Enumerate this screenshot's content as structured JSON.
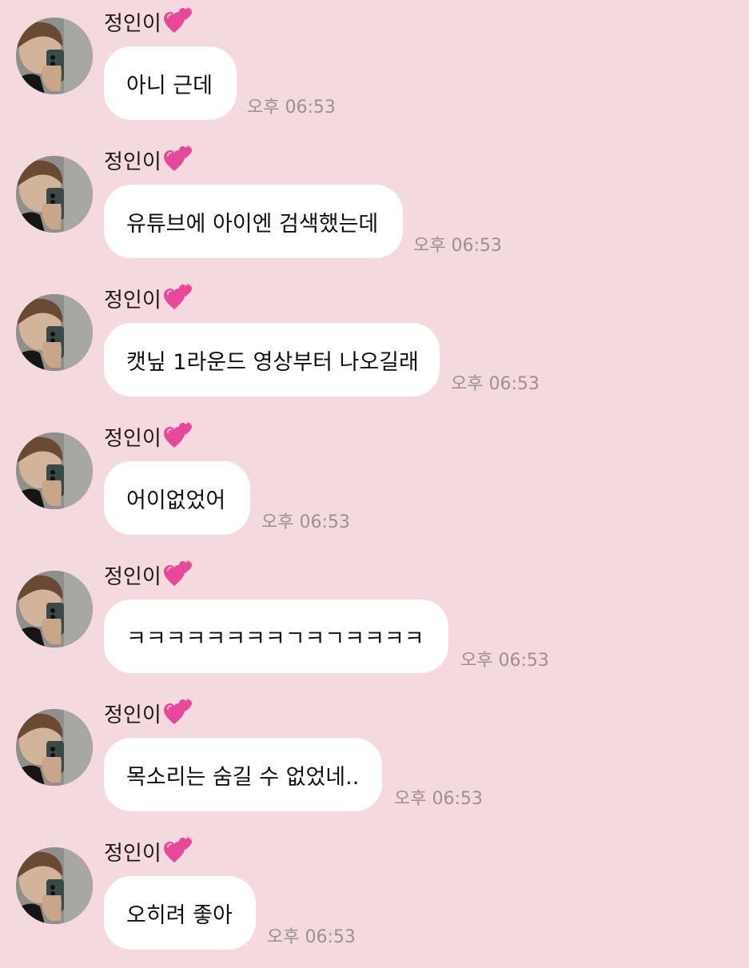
{
  "sender": "정인이",
  "heart_icon": "two-hearts-icon",
  "colors": {
    "background": "#f4d9df",
    "bubble": "#ffffff",
    "timestamp": "#9b9096",
    "heart": "#e8479a"
  },
  "messages": [
    {
      "text": "아니 근데",
      "time": "오후 06:53"
    },
    {
      "text": "유튜브에 아이엔 검색했는데",
      "time": "오후 06:53"
    },
    {
      "text": "캣닢 1라운드 영상부터 나오길래",
      "time": "오후 06:53"
    },
    {
      "text": "어이없었어",
      "time": "오후 06:53"
    },
    {
      "text": "ㅋㅋㅋㅋㅋㅋㅋㅋㄱㅋㄱㅋㅋㅋㅋ",
      "time": "오후 06:53"
    },
    {
      "text": "목소리는 숨길 수 없었네..",
      "time": "오후 06:53"
    },
    {
      "text": "오히려 좋아",
      "time": "오후 06:53"
    }
  ]
}
